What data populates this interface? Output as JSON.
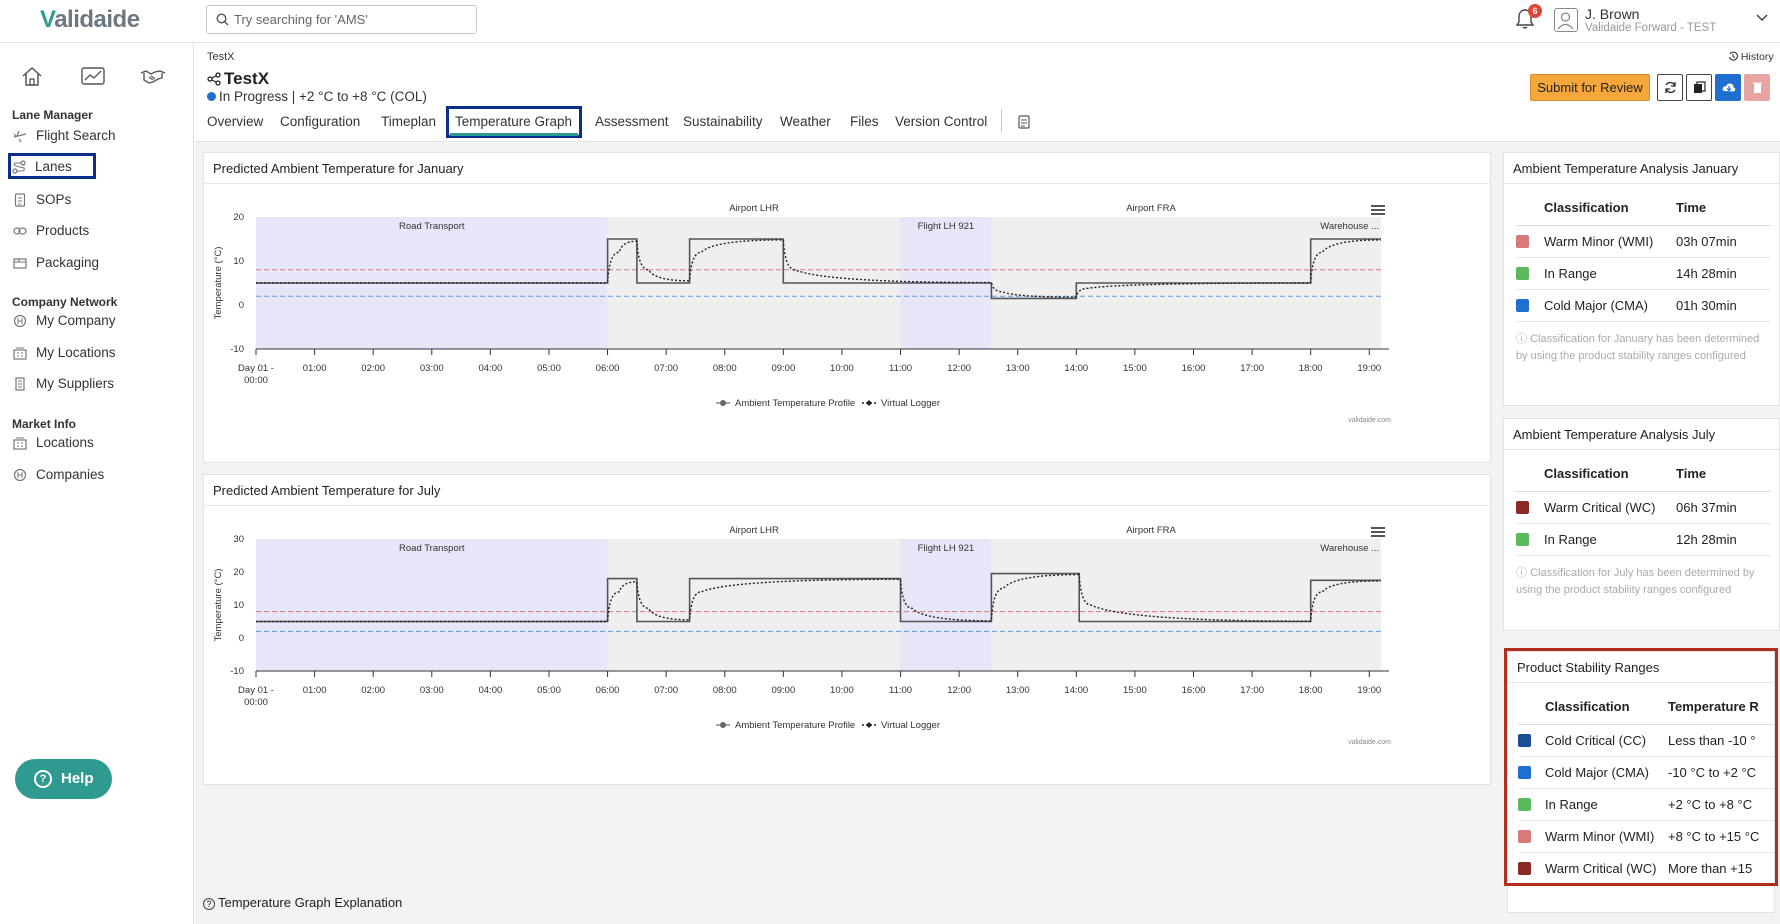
{
  "header": {
    "logo_text": "Validaide",
    "search_placeholder": "Try searching for 'AMS'",
    "notification_count": "6",
    "user_name": "J. Brown",
    "user_org": "Validaide Forward - TEST"
  },
  "sidebar": {
    "lane_manager_title": "Lane Manager",
    "lane_items": [
      {
        "label": "Flight Search",
        "icon": "airplane-icon"
      },
      {
        "label": "Lanes",
        "icon": "route-icon",
        "active": true
      },
      {
        "label": "SOPs",
        "icon": "document-icon"
      },
      {
        "label": "Products",
        "icon": "product-icon"
      },
      {
        "label": "Packaging",
        "icon": "box-icon"
      }
    ],
    "company_title": "Company Network",
    "company_items": [
      {
        "label": "My Company",
        "icon": "company-icon"
      },
      {
        "label": "My Locations",
        "icon": "building-icon"
      },
      {
        "label": "My Suppliers",
        "icon": "supplier-icon"
      }
    ],
    "market_title": "Market Info",
    "market_items": [
      {
        "label": "Locations",
        "icon": "building-icon"
      },
      {
        "label": "Companies",
        "icon": "company-icon"
      }
    ],
    "help_label": "Help"
  },
  "page": {
    "breadcrumb": "TestX",
    "title": "TestX",
    "status": "In Progress | +2 °C to +8 °C (COL)",
    "history_label": "History",
    "submit_label": "Submit for Review",
    "tabs": [
      "Overview",
      "Configuration",
      "Timeplan",
      "Temperature Graph",
      "Assessment",
      "Sustainability",
      "Weather",
      "Files",
      "Version Control"
    ],
    "active_tab": "Temperature Graph",
    "explanation_label": "Temperature Graph Explanation"
  },
  "colors": {
    "accent": "#2f9a8f",
    "highlight_blue": "#0a2f8a",
    "highlight_red": "#b22e1e",
    "cold_critical": "#1a4f96",
    "cold_major": "#1e6fd0",
    "in_range": "#5cb85c",
    "warm_minor": "#d97a7a",
    "warm_critical": "#8b2a22"
  },
  "chart_data": [
    {
      "type": "line",
      "title": "Predicted Ambient Temperature for January",
      "ylabel": "Temperature (°C)",
      "ylim": [
        -10,
        20
      ],
      "yticks": [
        "20",
        "10",
        "0",
        "-10"
      ],
      "xticks": [
        "Day 01 - 00:00",
        "01:00",
        "02:00",
        "03:00",
        "04:00",
        "05:00",
        "06:00",
        "07:00",
        "08:00",
        "09:00",
        "10:00",
        "11:00",
        "12:00",
        "13:00",
        "14:00",
        "15:00",
        "16:00",
        "17:00",
        "18:00",
        "19:00"
      ],
      "bands": [
        {
          "label": "Road Transport",
          "from": 0,
          "to": 6,
          "kind": "transport"
        },
        {
          "label": "Airport LHR",
          "from": 6,
          "to": 11,
          "kind": "airport"
        },
        {
          "label": "Flight LH 921",
          "from": 11,
          "to": 12.55,
          "kind": "transport"
        },
        {
          "label": "Airport FRA",
          "from": 12.55,
          "to": 18,
          "kind": "airport"
        },
        {
          "label": "Warehouse ...",
          "from": 18,
          "to": 19.2,
          "kind": "airport"
        }
      ],
      "ref_lines": [
        {
          "y": 8,
          "color": "#d97a7a"
        },
        {
          "y": 2,
          "color": "#5b9be0"
        }
      ],
      "series": [
        {
          "name": "Ambient Temperature Profile",
          "x": [
            0,
            6,
            6,
            6.5,
            6.5,
            7.4,
            7.4,
            9,
            9,
            12.55,
            12.55,
            14,
            14,
            18,
            18,
            19.2
          ],
          "y": [
            5,
            5,
            15,
            15,
            5,
            5,
            15,
            15,
            5,
            5,
            1.5,
            1.5,
            5,
            5,
            15,
            15
          ]
        },
        {
          "name": "Virtual Logger",
          "x": [
            0,
            6,
            6.2,
            6.5,
            6.7,
            7.4,
            7.6,
            9,
            9.2,
            12.55,
            12.75,
            14,
            14.2,
            18,
            18.2,
            19.2
          ],
          "y": [
            5,
            5,
            12,
            14.5,
            8,
            5.5,
            12,
            14.8,
            8,
            5.1,
            3,
            1.8,
            3.8,
            5,
            12,
            14.8
          ]
        }
      ]
    },
    {
      "type": "line",
      "title": "Predicted Ambient Temperature for July",
      "ylabel": "Temperature (°C)",
      "ylim": [
        -10,
        30
      ],
      "yticks": [
        "30",
        "20",
        "10",
        "0",
        "-10"
      ],
      "xticks": [
        "Day 01 - 00:00",
        "01:00",
        "02:00",
        "03:00",
        "04:00",
        "05:00",
        "06:00",
        "07:00",
        "08:00",
        "09:00",
        "10:00",
        "11:00",
        "12:00",
        "13:00",
        "14:00",
        "15:00",
        "16:00",
        "17:00",
        "18:00",
        "19:00"
      ],
      "bands": [
        {
          "label": "Road Transport",
          "from": 0,
          "to": 6,
          "kind": "transport"
        },
        {
          "label": "Airport LHR",
          "from": 6,
          "to": 11,
          "kind": "airport"
        },
        {
          "label": "Flight LH 921",
          "from": 11,
          "to": 12.55,
          "kind": "transport"
        },
        {
          "label": "Airport FRA",
          "from": 12.55,
          "to": 18,
          "kind": "airport"
        },
        {
          "label": "Warehouse ...",
          "from": 18,
          "to": 19.2,
          "kind": "airport"
        }
      ],
      "ref_lines": [
        {
          "y": 8,
          "color": "#d97a7a"
        },
        {
          "y": 2,
          "color": "#5b9be0"
        }
      ],
      "series": [
        {
          "name": "Ambient Temperature Profile",
          "x": [
            0,
            6,
            6,
            6.5,
            6.5,
            7.4,
            7.4,
            11,
            11,
            12.55,
            12.55,
            14.05,
            14.05,
            18,
            18,
            19.2
          ],
          "y": [
            5,
            5,
            18,
            18,
            5,
            5,
            18,
            18,
            5,
            5,
            19.5,
            19.5,
            5,
            5,
            17.5,
            17.5
          ]
        },
        {
          "name": "Virtual Logger",
          "x": [
            0,
            6,
            6.2,
            6.5,
            6.7,
            7.4,
            7.6,
            11,
            11.2,
            12.55,
            12.75,
            14.05,
            14.25,
            18,
            18.2,
            19.2
          ],
          "y": [
            5,
            5,
            14,
            17,
            9,
            5.5,
            14,
            17.8,
            9,
            5.2,
            15,
            19.2,
            10,
            5.1,
            14,
            17.3
          ]
        }
      ]
    }
  ],
  "legend": {
    "profile": "Ambient Temperature Profile",
    "logger": "Virtual Logger",
    "credit": "validaide.com"
  },
  "january_analysis": {
    "title": "Ambient Temperature Analysis January",
    "col1": "Classification",
    "col2": "Time",
    "rows": [
      {
        "label": "Warm Minor (WMI)",
        "time": "03h 07min",
        "color": "#d97a7a"
      },
      {
        "label": "In Range",
        "time": "14h 28min",
        "color": "#5cb85c"
      },
      {
        "label": "Cold Major (CMA)",
        "time": "01h 30min",
        "color": "#1e6fd0"
      }
    ],
    "note": "Classification for January has been determined by using the product stability ranges configured"
  },
  "july_analysis": {
    "title": "Ambient Temperature Analysis July",
    "col1": "Classification",
    "col2": "Time",
    "rows": [
      {
        "label": "Warm Critical (WC)",
        "time": "06h 37min",
        "color": "#8b2a22"
      },
      {
        "label": "In Range",
        "time": "12h 28min",
        "color": "#5cb85c"
      }
    ],
    "note": "Classification for July has been determined by using the product stability ranges configured"
  },
  "stability": {
    "title": "Product Stability Ranges",
    "col1": "Classification",
    "col2": "Temperature R",
    "rows": [
      {
        "label": "Cold Critical (CC)",
        "range": "Less than -10 °",
        "color": "#1a4f96"
      },
      {
        "label": "Cold Major (CMA)",
        "range": "-10 °C to +2 °C",
        "color": "#1e6fd0"
      },
      {
        "label": "In Range",
        "range": "+2 °C to +8 °C",
        "color": "#5cb85c"
      },
      {
        "label": "Warm Minor (WMI)",
        "range": "+8 °C to +15 °C",
        "color": "#d97a7a"
      },
      {
        "label": "Warm Critical (WC)",
        "range": "More than +15",
        "color": "#8b2a22"
      }
    ]
  }
}
